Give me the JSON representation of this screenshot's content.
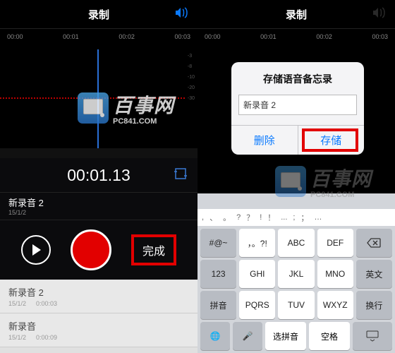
{
  "left": {
    "title": "录制",
    "ticks": [
      "00:00",
      "00:01",
      "00:02",
      "00:03"
    ],
    "db": [
      "-3",
      "-8",
      "-10",
      "-20",
      "-30"
    ],
    "timecode": "00:01.13",
    "current": {
      "name": "新录音 2",
      "date": "15/1/2"
    },
    "done_label": "完成",
    "list": [
      {
        "name": "新录音 2",
        "date": "15/1/2",
        "dur": "0:00:03"
      },
      {
        "name": "新录音",
        "date": "15/1/2",
        "dur": "0:00:09"
      }
    ]
  },
  "right": {
    "title": "录制",
    "ticks": [
      "00:00",
      "00:01",
      "00:02",
      "00:03"
    ],
    "dialog": {
      "title": "存储语音备忘录",
      "input_value": "新录音 2",
      "delete_label": "删除",
      "save_label": "存储"
    },
    "punct": [
      ",",
      "、",
      "。",
      "?",
      "？",
      "!",
      "！",
      "...",
      ";",
      "；",
      "…"
    ],
    "keys_r1": [
      "#@~",
      "，。?!",
      "ABC",
      "DEF",
      "⌫"
    ],
    "keys_r2": [
      "123",
      "GHI",
      "JKL",
      "MNO",
      "英文"
    ],
    "keys_r3": [
      "拼音",
      "PQRS",
      "TUV",
      "WXYZ",
      "换行"
    ],
    "bottom": {
      "globe": "🌐",
      "mic": "🎤",
      "select": "选拼音",
      "space": "空格"
    }
  },
  "watermark": {
    "cn": "百事网",
    "en": "PC841.COM"
  }
}
